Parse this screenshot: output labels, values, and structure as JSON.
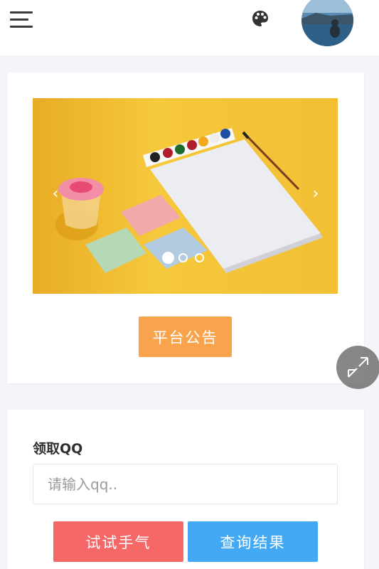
{
  "header": {
    "menu_icon": "hamburger-menu-icon",
    "theme_icon": "palette-icon",
    "avatar_icon": "user-avatar"
  },
  "banner": {
    "prev_label": "‹",
    "next_label": "›",
    "slide_count": 3,
    "active_slide": 1,
    "image_subject": "watercolor-paint-set-illustration"
  },
  "notice": {
    "button_label": "平台公告"
  },
  "float_button": {
    "icon": "collapse-arrows-icon"
  },
  "claim": {
    "title": "领取QQ",
    "input_placeholder": "请输入qq..",
    "input_value": "",
    "try_button_label": "试试手气",
    "query_button_label": "查询结果"
  },
  "colors": {
    "page_bg": "#f3f5f9",
    "banner_bg": "#f3c134",
    "notice_button": "#f9a44c",
    "try_button": "#f66868",
    "query_button": "#43a9f5"
  }
}
